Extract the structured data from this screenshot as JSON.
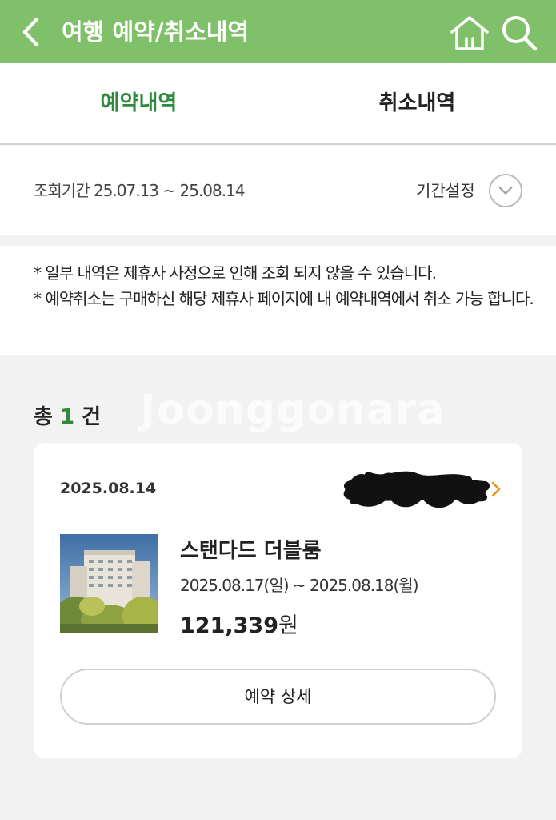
{
  "header": {
    "title": "여행 예약/취소내역",
    "icons": {
      "back": "chevron-left-icon",
      "home": "home-icon",
      "search": "search-icon"
    },
    "bg_color": "#80c06a"
  },
  "tabs": [
    {
      "label": "예약내역",
      "active": true
    },
    {
      "label": "취소내역",
      "active": false
    }
  ],
  "period": {
    "label": "조회기간 25.07.13 ~ 25.08.14",
    "set_label": "기간설정"
  },
  "notices": [
    "* 일부 내역은 제휴사 사정으로 인해 조회 되지 않을 수 있습니다.",
    "* 예약취소는 구매하신 해당 제휴사 페이지에 내 예약내역에서 취소 가능 합니다."
  ],
  "summary": {
    "prefix": "총",
    "count": "1",
    "suffix": "건"
  },
  "watermark": "Joonggonara",
  "booking": {
    "date": "2025.08.14",
    "room": "스탠다드 더블룸",
    "stay": "2025.08.17(일) ~ 2025.08.18(월)",
    "price": "121,339",
    "currency": "원",
    "detail_button": "예약 상세"
  },
  "colors": {
    "accent_green": "#2f8a3e",
    "arrow_orange": "#e8930c"
  }
}
